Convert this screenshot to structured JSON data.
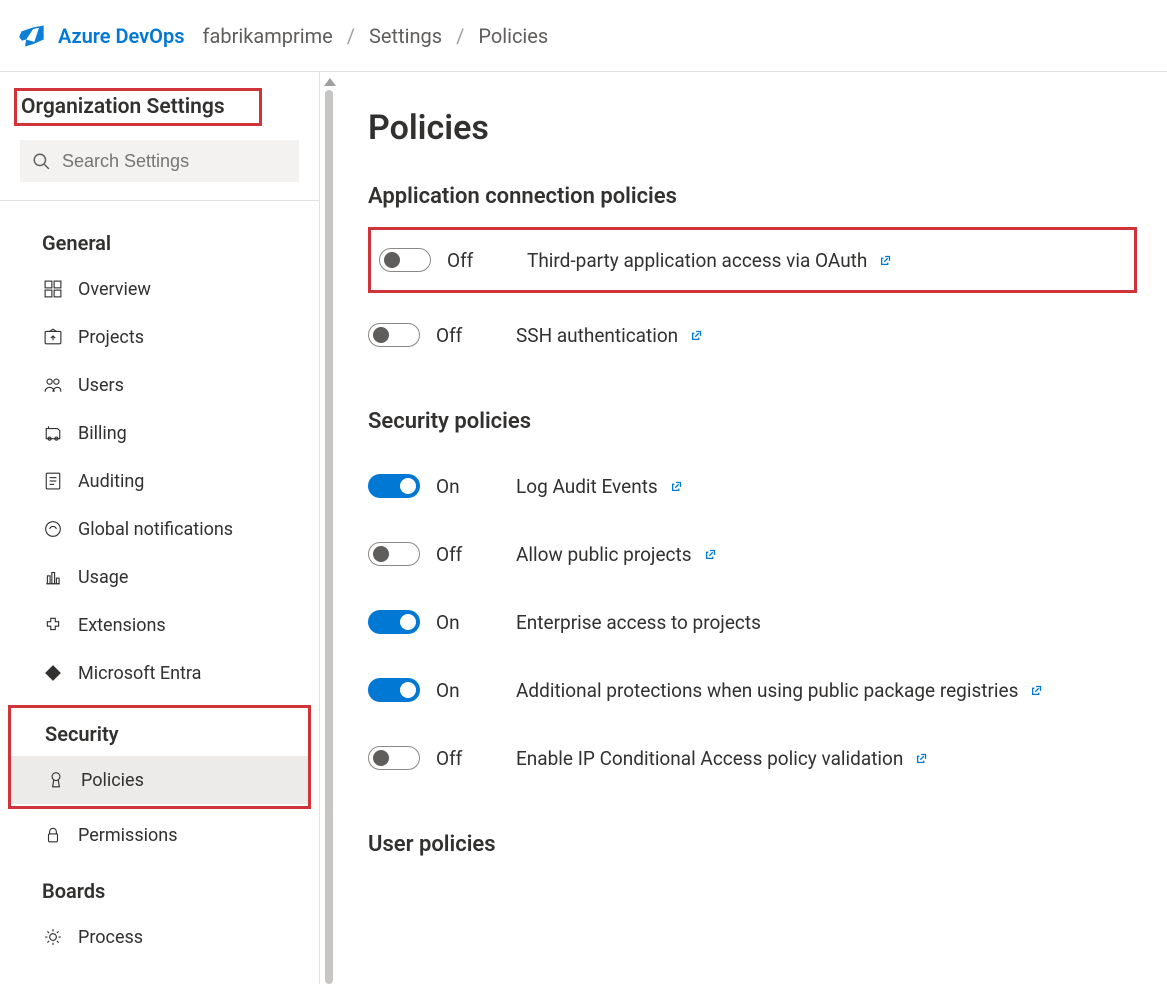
{
  "header": {
    "brand": "Azure DevOps",
    "breadcrumbs": [
      "fabrikamprime",
      "Settings",
      "Policies"
    ]
  },
  "sidebar": {
    "title": "Organization Settings",
    "search_placeholder": "Search Settings",
    "groups": [
      {
        "label": "General",
        "items": [
          {
            "icon": "overview",
            "label": "Overview"
          },
          {
            "icon": "projects",
            "label": "Projects"
          },
          {
            "icon": "users",
            "label": "Users"
          },
          {
            "icon": "billing",
            "label": "Billing"
          },
          {
            "icon": "auditing",
            "label": "Auditing"
          },
          {
            "icon": "notifications",
            "label": "Global notifications"
          },
          {
            "icon": "usage",
            "label": "Usage"
          },
          {
            "icon": "extensions",
            "label": "Extensions"
          },
          {
            "icon": "entra",
            "label": "Microsoft Entra"
          }
        ]
      },
      {
        "label": "Security",
        "items": [
          {
            "icon": "policies",
            "label": "Policies",
            "selected": true
          },
          {
            "icon": "permissions",
            "label": "Permissions"
          }
        ]
      },
      {
        "label": "Boards",
        "items": [
          {
            "icon": "process",
            "label": "Process"
          }
        ]
      }
    ]
  },
  "main": {
    "title": "Policies",
    "sections": [
      {
        "title": "Application connection policies",
        "policies": [
          {
            "on": false,
            "label": "Third-party application access via OAuth",
            "link": true,
            "highlight": true
          },
          {
            "on": false,
            "label": "SSH authentication",
            "link": true
          }
        ]
      },
      {
        "title": "Security policies",
        "policies": [
          {
            "on": true,
            "label": "Log Audit Events",
            "link": true
          },
          {
            "on": false,
            "label": "Allow public projects",
            "link": true
          },
          {
            "on": true,
            "label": "Enterprise access to projects",
            "link": false
          },
          {
            "on": true,
            "label": "Additional protections when using public package registries",
            "link": true
          },
          {
            "on": false,
            "label": "Enable IP Conditional Access policy validation",
            "link": true
          }
        ]
      },
      {
        "title": "User policies",
        "policies": []
      }
    ],
    "state_on": "On",
    "state_off": "Off"
  }
}
